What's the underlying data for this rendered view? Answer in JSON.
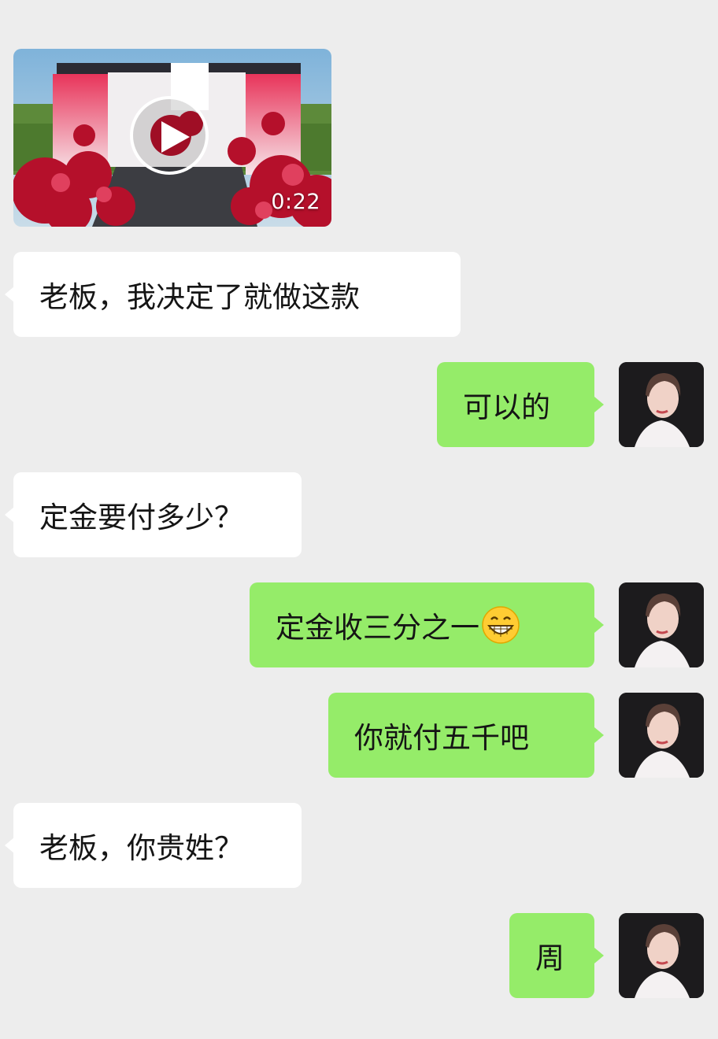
{
  "video": {
    "duration": "0:22",
    "icon": "play-icon"
  },
  "messages": [
    {
      "from": "contact",
      "text": "老板，我决定了就做这款"
    },
    {
      "from": "me",
      "text": "可以的"
    },
    {
      "from": "contact",
      "text": "定金要付多少？"
    },
    {
      "from": "me",
      "text": "定金收三分之一",
      "emoji": "grinning-face-icon"
    },
    {
      "from": "me",
      "text": "你就付五千吧"
    },
    {
      "from": "contact",
      "text": "老板，你贵姓？"
    },
    {
      "from": "me",
      "text": "周"
    }
  ],
  "colors": {
    "background": "#ededed",
    "incoming_bubble": "#ffffff",
    "outgoing_bubble": "#95ec69"
  }
}
